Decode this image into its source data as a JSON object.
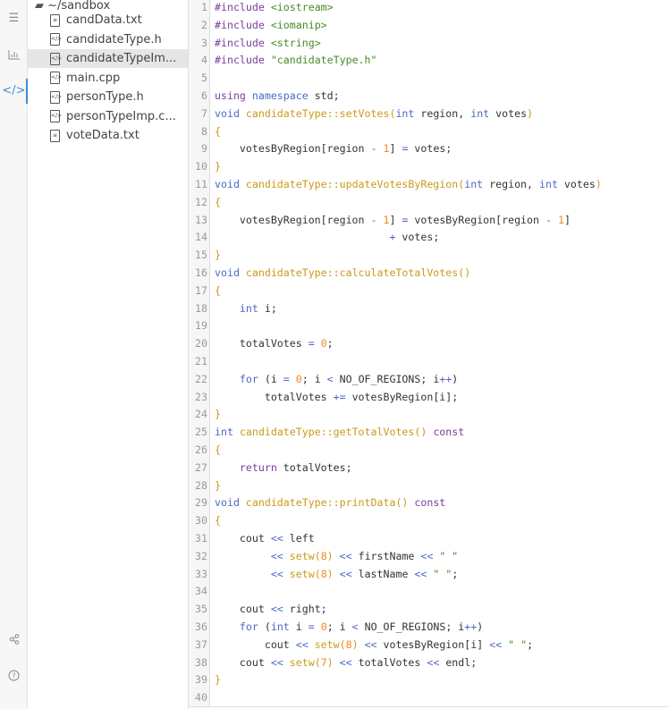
{
  "rail": {
    "icons": [
      "checklist-icon",
      "chart-icon",
      "code-icon",
      "share-icon",
      "help-icon"
    ]
  },
  "tree": {
    "folder": "~/sandbox",
    "files": [
      {
        "name": "candData.txt",
        "type": "text"
      },
      {
        "name": "candidateType.h",
        "type": "code"
      },
      {
        "name": "candidateTypeIm...",
        "type": "code",
        "selected": true
      },
      {
        "name": "main.cpp",
        "type": "code"
      },
      {
        "name": "personType.h",
        "type": "code"
      },
      {
        "name": "personTypeImp.c...",
        "type": "code"
      },
      {
        "name": "voteData.txt",
        "type": "text"
      }
    ]
  },
  "code": [
    [
      [
        "k",
        "#include"
      ],
      [
        "p",
        " "
      ],
      [
        "s",
        "<iostream>"
      ]
    ],
    [
      [
        "k",
        "#include"
      ],
      [
        "p",
        " "
      ],
      [
        "s",
        "<iomanip>"
      ]
    ],
    [
      [
        "k",
        "#include"
      ],
      [
        "p",
        " "
      ],
      [
        "s",
        "<string>"
      ]
    ],
    [
      [
        "k",
        "#include"
      ],
      [
        "p",
        " "
      ],
      [
        "s",
        "\"candidateType.h\""
      ]
    ],
    [],
    [
      [
        "k",
        "using"
      ],
      [
        "p",
        " "
      ],
      [
        "t",
        "namespace"
      ],
      [
        "p",
        " std;"
      ]
    ],
    [
      [
        "t",
        "void"
      ],
      [
        "p",
        " "
      ],
      [
        "f",
        "candidateType::setVotes("
      ],
      [
        "t",
        "int"
      ],
      [
        "p",
        " region, "
      ],
      [
        "t",
        "int"
      ],
      [
        "p",
        " votes"
      ],
      [
        "f",
        ")"
      ]
    ],
    [
      [
        "f",
        "{"
      ]
    ],
    [
      [
        "p",
        "    votesByRegion[region "
      ],
      [
        "t",
        "-"
      ],
      [
        "p",
        " "
      ],
      [
        "n",
        "1"
      ],
      [
        "p",
        "] "
      ],
      [
        "t",
        "="
      ],
      [
        "p",
        " votes;"
      ]
    ],
    [
      [
        "f",
        "}"
      ]
    ],
    [
      [
        "t",
        "void"
      ],
      [
        "p",
        " "
      ],
      [
        "f",
        "candidateType::updateVotesByRegion("
      ],
      [
        "t",
        "int"
      ],
      [
        "p",
        " region, "
      ],
      [
        "t",
        "int"
      ],
      [
        "p",
        " votes"
      ],
      [
        "f",
        ")"
      ]
    ],
    [
      [
        "f",
        "{"
      ]
    ],
    [
      [
        "p",
        "    votesByRegion[region "
      ],
      [
        "t",
        "-"
      ],
      [
        "p",
        " "
      ],
      [
        "n",
        "1"
      ],
      [
        "p",
        "] "
      ],
      [
        "t",
        "="
      ],
      [
        "p",
        " votesByRegion[region "
      ],
      [
        "t",
        "-"
      ],
      [
        "p",
        " "
      ],
      [
        "n",
        "1"
      ],
      [
        "p",
        "]"
      ]
    ],
    [
      [
        "p",
        "                            "
      ],
      [
        "t",
        "+"
      ],
      [
        "p",
        " votes;"
      ]
    ],
    [
      [
        "f",
        "}"
      ]
    ],
    [
      [
        "t",
        "void"
      ],
      [
        "p",
        " "
      ],
      [
        "f",
        "candidateType::calculateTotalVotes()"
      ]
    ],
    [
      [
        "f",
        "{"
      ]
    ],
    [
      [
        "p",
        "    "
      ],
      [
        "t",
        "int"
      ],
      [
        "p",
        " i;"
      ]
    ],
    [],
    [
      [
        "p",
        "    totalVotes "
      ],
      [
        "t",
        "="
      ],
      [
        "p",
        " "
      ],
      [
        "n",
        "0"
      ],
      [
        "p",
        ";"
      ]
    ],
    [],
    [
      [
        "p",
        "    "
      ],
      [
        "t",
        "for"
      ],
      [
        "p",
        " (i "
      ],
      [
        "t",
        "="
      ],
      [
        "p",
        " "
      ],
      [
        "n",
        "0"
      ],
      [
        "p",
        "; i "
      ],
      [
        "t",
        "<"
      ],
      [
        "p",
        " NO_OF_REGIONS; i"
      ],
      [
        "t",
        "++"
      ],
      [
        "p",
        ")"
      ]
    ],
    [
      [
        "p",
        "        totalVotes "
      ],
      [
        "t",
        "+="
      ],
      [
        "p",
        " votesByRegion[i];"
      ]
    ],
    [
      [
        "f",
        "}"
      ]
    ],
    [
      [
        "t",
        "int"
      ],
      [
        "p",
        " "
      ],
      [
        "f",
        "candidateType::getTotalVotes()"
      ],
      [
        "p",
        " "
      ],
      [
        "k",
        "const"
      ]
    ],
    [
      [
        "f",
        "{"
      ]
    ],
    [
      [
        "p",
        "    "
      ],
      [
        "k",
        "return"
      ],
      [
        "p",
        " totalVotes;"
      ]
    ],
    [
      [
        "f",
        "}"
      ]
    ],
    [
      [
        "t",
        "void"
      ],
      [
        "p",
        " "
      ],
      [
        "f",
        "candidateType::printData()"
      ],
      [
        "p",
        " "
      ],
      [
        "k",
        "const"
      ]
    ],
    [
      [
        "f",
        "{"
      ]
    ],
    [
      [
        "p",
        "    cout "
      ],
      [
        "t",
        "<<"
      ],
      [
        "p",
        " left"
      ]
    ],
    [
      [
        "p",
        "         "
      ],
      [
        "t",
        "<<"
      ],
      [
        "p",
        " "
      ],
      [
        "f",
        "setw("
      ],
      [
        "n",
        "8"
      ],
      [
        "f",
        ")"
      ],
      [
        "p",
        " "
      ],
      [
        "t",
        "<<"
      ],
      [
        "p",
        " firstName "
      ],
      [
        "t",
        "<<"
      ],
      [
        "p",
        " "
      ],
      [
        "s",
        "\" \""
      ]
    ],
    [
      [
        "p",
        "         "
      ],
      [
        "t",
        "<<"
      ],
      [
        "p",
        " "
      ],
      [
        "f",
        "setw("
      ],
      [
        "n",
        "8"
      ],
      [
        "f",
        ")"
      ],
      [
        "p",
        " "
      ],
      [
        "t",
        "<<"
      ],
      [
        "p",
        " lastName "
      ],
      [
        "t",
        "<<"
      ],
      [
        "p",
        " "
      ],
      [
        "s",
        "\" \""
      ],
      [
        "p",
        ";"
      ]
    ],
    [],
    [
      [
        "p",
        "    cout "
      ],
      [
        "t",
        "<<"
      ],
      [
        "p",
        " right;"
      ]
    ],
    [
      [
        "p",
        "    "
      ],
      [
        "t",
        "for"
      ],
      [
        "p",
        " ("
      ],
      [
        "t",
        "int"
      ],
      [
        "p",
        " i "
      ],
      [
        "t",
        "="
      ],
      [
        "p",
        " "
      ],
      [
        "n",
        "0"
      ],
      [
        "p",
        "; i "
      ],
      [
        "t",
        "<"
      ],
      [
        "p",
        " NO_OF_REGIONS; i"
      ],
      [
        "t",
        "++"
      ],
      [
        "p",
        ")"
      ]
    ],
    [
      [
        "p",
        "        cout "
      ],
      [
        "t",
        "<<"
      ],
      [
        "p",
        " "
      ],
      [
        "f",
        "setw("
      ],
      [
        "n",
        "8"
      ],
      [
        "f",
        ")"
      ],
      [
        "p",
        " "
      ],
      [
        "t",
        "<<"
      ],
      [
        "p",
        " votesByRegion[i] "
      ],
      [
        "t",
        "<<"
      ],
      [
        "p",
        " "
      ],
      [
        "s",
        "\" \""
      ],
      [
        "p",
        ";"
      ]
    ],
    [
      [
        "p",
        "    cout "
      ],
      [
        "t",
        "<<"
      ],
      [
        "p",
        " "
      ],
      [
        "f",
        "setw("
      ],
      [
        "n",
        "7"
      ],
      [
        "f",
        ")"
      ],
      [
        "p",
        " "
      ],
      [
        "t",
        "<<"
      ],
      [
        "p",
        " totalVotes "
      ],
      [
        "t",
        "<<"
      ],
      [
        "p",
        " endl;"
      ]
    ],
    [
      [
        "f",
        "}"
      ]
    ],
    []
  ]
}
